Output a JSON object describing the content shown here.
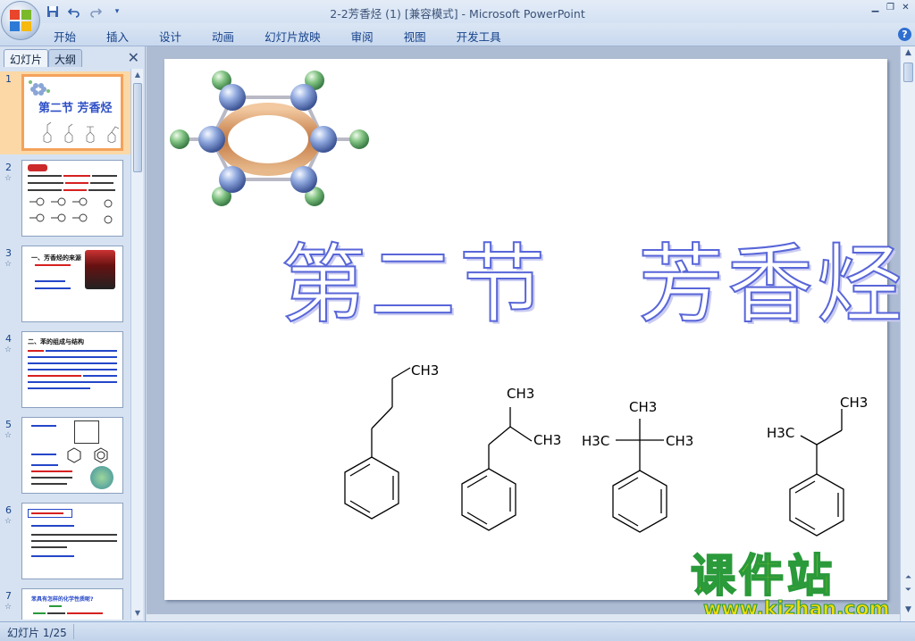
{
  "window": {
    "title": "2-2芳香烃 (1) [兼容模式] - Microsoft PowerPoint"
  },
  "quick_access": {
    "items": [
      "save-icon",
      "undo-icon",
      "redo-icon",
      "customize-icon"
    ]
  },
  "ribbon": {
    "tabs": [
      "开始",
      "插入",
      "设计",
      "动画",
      "幻灯片放映",
      "审阅",
      "视图",
      "开发工具"
    ]
  },
  "left_pane": {
    "tab_slides": "幻灯片",
    "tab_outline": "大纲",
    "slides": [
      {
        "num": "1",
        "title": "第二节 芳香烃"
      },
      {
        "num": "2",
        "title": ""
      },
      {
        "num": "3",
        "title": "一、芳香烃的来源"
      },
      {
        "num": "4",
        "title": "二、苯的组成与结构"
      },
      {
        "num": "5",
        "title": ""
      },
      {
        "num": "6",
        "title": ""
      },
      {
        "num": "7",
        "title": "苯具有怎样的化学性质呢?"
      }
    ]
  },
  "slide": {
    "title": "第二节　芳香烃",
    "molecules": [
      {
        "labels": [
          "CH3"
        ]
      },
      {
        "labels": [
          "CH3",
          "CH3"
        ]
      },
      {
        "labels": [
          "CH3",
          "H3C",
          "CH3"
        ]
      },
      {
        "labels": [
          "CH3",
          "H3C"
        ]
      }
    ]
  },
  "watermark": {
    "text": "课件站",
    "url": "www.kjzhan.com"
  },
  "status": {
    "slide_counter": "幻灯片 1/25"
  }
}
